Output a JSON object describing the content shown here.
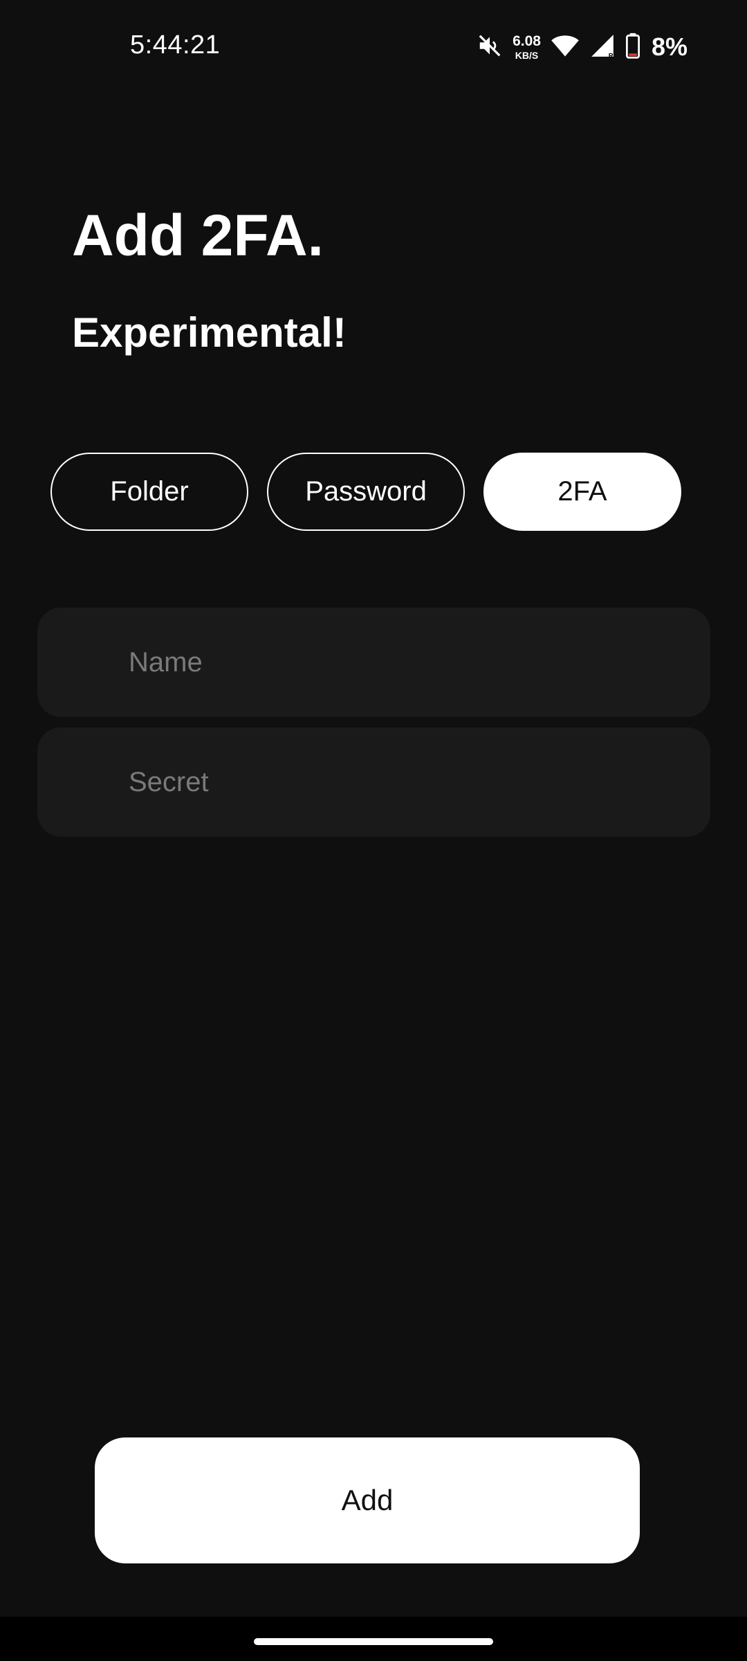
{
  "status_bar": {
    "time": "5:44:21",
    "net_speed_value": "6.08",
    "net_speed_unit": "KB/S",
    "battery_percent": "8%",
    "icons": [
      "mute-icon",
      "wifi-icon",
      "cellular-signal-icon",
      "battery-icon"
    ]
  },
  "header": {
    "title": "Add 2FA.",
    "subtitle": "Experimental!"
  },
  "tabs": [
    {
      "label": "Folder",
      "active": false
    },
    {
      "label": "Password",
      "active": false
    },
    {
      "label": "2FA",
      "active": true
    }
  ],
  "form": {
    "name_placeholder": "Name",
    "name_value": "",
    "secret_placeholder": "Secret",
    "secret_value": ""
  },
  "actions": {
    "add_label": "Add"
  },
  "colors": {
    "background": "#0f0f0f",
    "field_background": "#1a1a1a",
    "accent": "#ffffff",
    "placeholder": "#7a7a7a",
    "battery_low": "#e53935"
  }
}
